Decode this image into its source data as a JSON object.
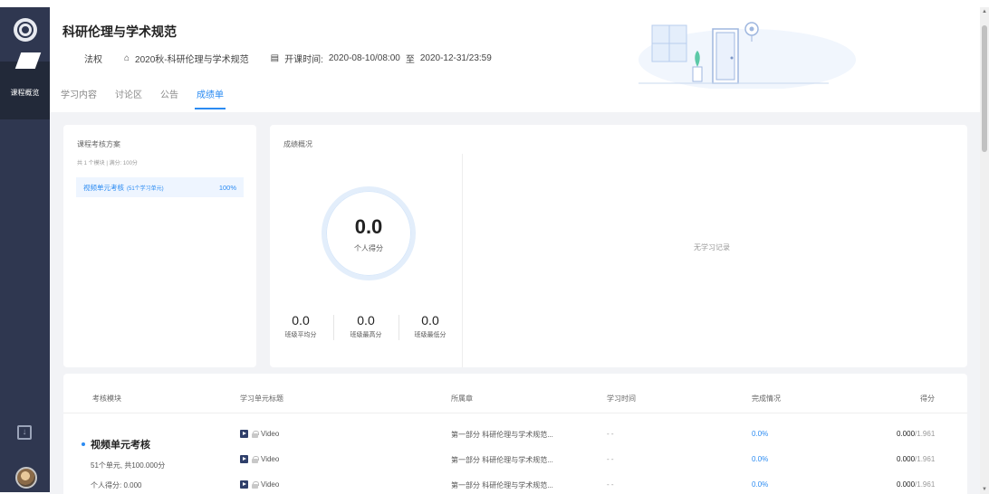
{
  "rail": {
    "active_label": "课程概览"
  },
  "header": {
    "course_title": "科研伦理与学术规范",
    "teacher": "法权",
    "class_name": "2020秋-科研伦理与学术规范",
    "time_label": "开课时间:",
    "time_start": "2020-08-10/08:00",
    "time_sep": "至",
    "time_end": "2020-12-31/23:59"
  },
  "tabs": [
    {
      "label": "学习内容"
    },
    {
      "label": "讨论区"
    },
    {
      "label": "公告"
    },
    {
      "label": "成绩单"
    }
  ],
  "active_tab": "成绩单",
  "plan": {
    "title": "课程考核方案",
    "summary": "共 1 个模块 | 满分: 100分",
    "item_name": "视频单元考核",
    "item_detail": "(51个学习单元)",
    "item_pct": "100%"
  },
  "overview": {
    "title": "成绩概况",
    "personal_value": "0.0",
    "personal_label": "个人得分",
    "stats": [
      {
        "value": "0.0",
        "label": "班级平均分"
      },
      {
        "value": "0.0",
        "label": "班级最高分"
      },
      {
        "value": "0.0",
        "label": "班级最低分"
      }
    ],
    "empty_text": "无学习记录"
  },
  "table": {
    "headers": [
      "考核模块",
      "学习单元标题",
      "所属章",
      "学习时间",
      "完成情况",
      "得分"
    ],
    "module": {
      "name": "视频单元考核",
      "units": "51个单元, 共100.000分",
      "score": "个人得分: 0.000"
    },
    "rows": [
      {
        "title": "Video",
        "chapter": "第一部分 科研伦理与学术规范...",
        "time": "- -",
        "completion": "0.0%",
        "score": "0.000",
        "total": "/1.961"
      },
      {
        "title": "Video",
        "chapter": "第一部分 科研伦理与学术规范...",
        "time": "- -",
        "completion": "0.0%",
        "score": "0.000",
        "total": "/1.961"
      },
      {
        "title": "Video",
        "chapter": "第一部分 科研伦理与学术规范...",
        "time": "- -",
        "completion": "0.0%",
        "score": "0.000",
        "total": "/1.961"
      }
    ]
  },
  "colors": {
    "accent": "#2b8bf2",
    "rail": "#2f3750",
    "background": "#f2f3f6"
  }
}
